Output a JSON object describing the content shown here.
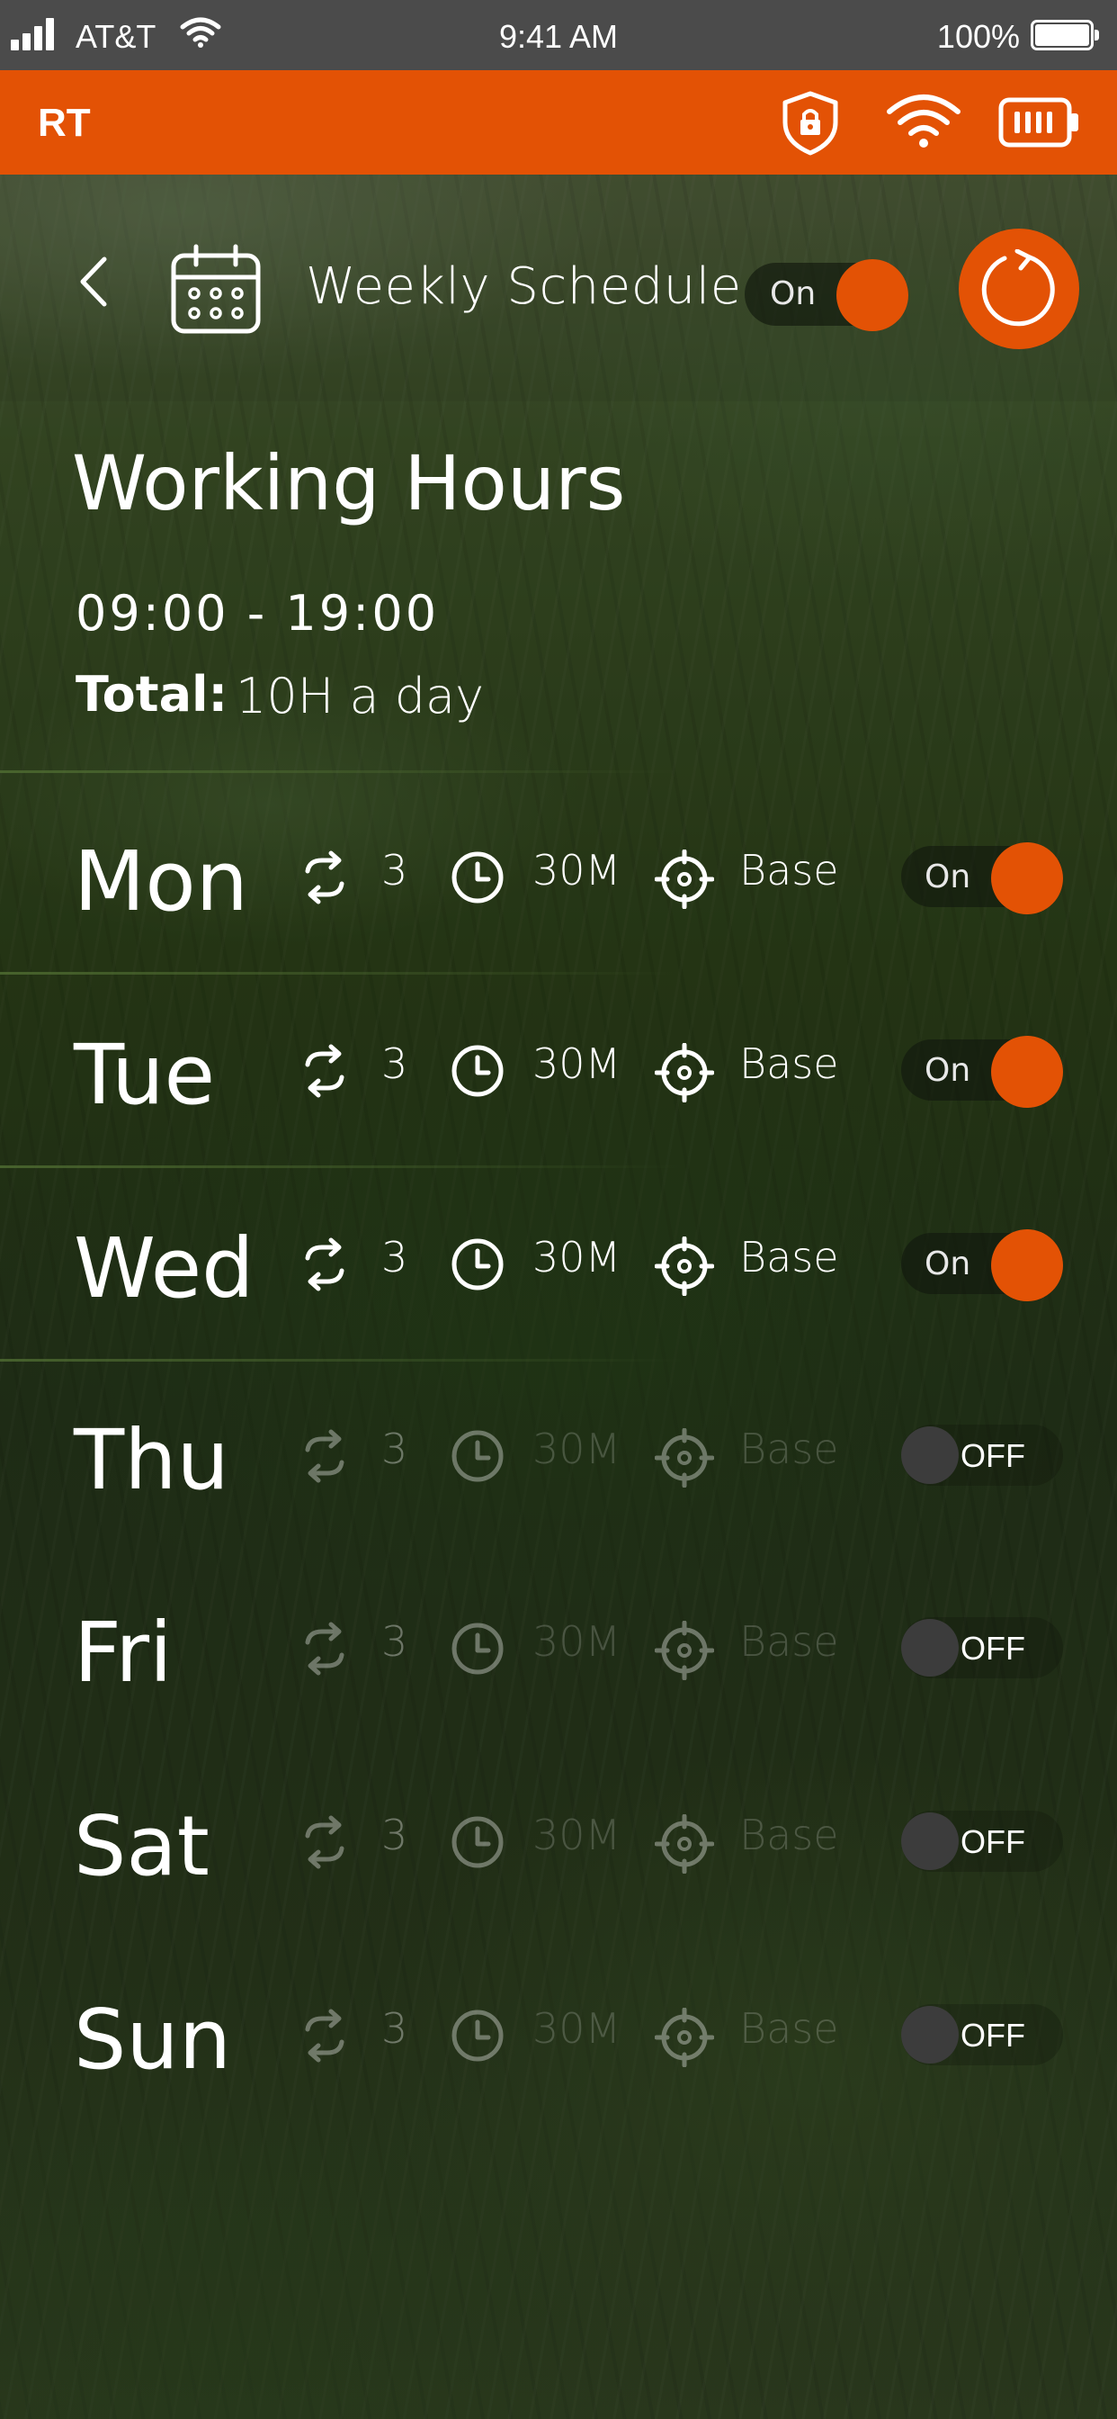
{
  "status_bar": {
    "carrier": "AT&T",
    "time": "9:41 AM",
    "battery": "100%"
  },
  "header": {
    "app_name": "RT",
    "icons": [
      "shield-lock-icon",
      "wifi-icon",
      "battery-icon"
    ]
  },
  "schedule": {
    "title": "Weekly Schedule",
    "toggle_label": "On",
    "enabled": true,
    "accent_color": "#e35205"
  },
  "working_hours": {
    "title": "Working Hours",
    "range": "09:00 - 19:00",
    "total_label": "Total:",
    "total_value": "10H a day"
  },
  "days": [
    {
      "name": "Mon",
      "repeat": "3",
      "duration": "30M",
      "location": "Base",
      "state": "On",
      "enabled": true
    },
    {
      "name": "Tue",
      "repeat": "3",
      "duration": "30M",
      "location": "Base",
      "state": "On",
      "enabled": true
    },
    {
      "name": "Wed",
      "repeat": "3",
      "duration": "30M",
      "location": "Base",
      "state": "On",
      "enabled": true
    },
    {
      "name": "Thu",
      "repeat": "3",
      "duration": "30M",
      "location": "Base",
      "state": "OFF",
      "enabled": false
    },
    {
      "name": "Fri",
      "repeat": "3",
      "duration": "30M",
      "location": "Base",
      "state": "OFF",
      "enabled": false
    },
    {
      "name": "Sat",
      "repeat": "3",
      "duration": "30M",
      "location": "Base",
      "state": "OFF",
      "enabled": false
    },
    {
      "name": "Sun",
      "repeat": "3",
      "duration": "30M",
      "location": "Base",
      "state": "OFF",
      "enabled": false
    }
  ]
}
